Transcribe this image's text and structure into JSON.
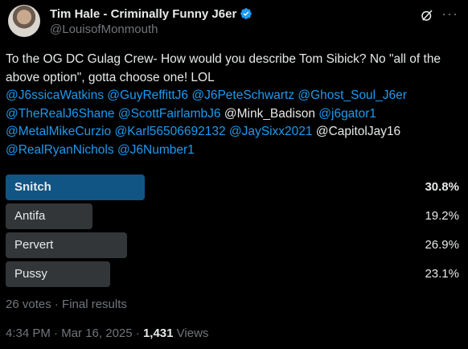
{
  "author": {
    "display_name": "Tim Hale - Criminally Funny J6er",
    "handle": "@LouisofMonmouth"
  },
  "tweet": {
    "segments": [
      {
        "text": "To the OG DC Gulag Crew- How would you describe Tom Sibick? No \"all of the above option\", gotta choose one! LOL",
        "type": "text"
      },
      {
        "text": "\n",
        "type": "break"
      },
      {
        "text": "@J6ssicaWatkins",
        "type": "mention"
      },
      {
        "text": " ",
        "type": "text"
      },
      {
        "text": "@GuyReffittJ6",
        "type": "mention"
      },
      {
        "text": " ",
        "type": "text"
      },
      {
        "text": "@J6PeteSchwartz",
        "type": "mention"
      },
      {
        "text": " ",
        "type": "text"
      },
      {
        "text": "@Ghost_Soul_J6er",
        "type": "mention"
      },
      {
        "text": " ",
        "type": "text"
      },
      {
        "text": "@TheRealJ6Shane",
        "type": "mention"
      },
      {
        "text": " ",
        "type": "text"
      },
      {
        "text": "@ScottFairlambJ6",
        "type": "mention"
      },
      {
        "text": " @Mink_Badison ",
        "type": "text"
      },
      {
        "text": "@j6gator1",
        "type": "mention"
      },
      {
        "text": " ",
        "type": "text"
      },
      {
        "text": "@MetalMikeCurzio",
        "type": "mention"
      },
      {
        "text": " ",
        "type": "text"
      },
      {
        "text": "@Karl56506692132",
        "type": "mention"
      },
      {
        "text": " ",
        "type": "text"
      },
      {
        "text": "@JaySixx2021",
        "type": "mention"
      },
      {
        "text": " @CapitolJay16 ",
        "type": "text"
      },
      {
        "text": "@RealRyanNichols",
        "type": "mention"
      },
      {
        "text": " ",
        "type": "text"
      },
      {
        "text": "@J6Number1",
        "type": "mention"
      }
    ]
  },
  "poll": {
    "options": [
      {
        "label": "Snitch",
        "percent_text": "30.8%",
        "percent": 30.8,
        "winner": true
      },
      {
        "label": "Antifa",
        "percent_text": "19.2%",
        "percent": 19.2,
        "winner": false
      },
      {
        "label": "Pervert",
        "percent_text": "26.9%",
        "percent": 26.9,
        "winner": false
      },
      {
        "label": "Pussy",
        "percent_text": "23.1%",
        "percent": 23.1,
        "winner": false
      }
    ],
    "meta": "26 votes · Final results"
  },
  "footer": {
    "time": "4:34 PM",
    "date": "Mar 16, 2025",
    "views_count": "1,431",
    "views_label": "Views"
  },
  "colors": {
    "accent": "#1d9bf0",
    "muted": "#71767b",
    "bar": "#333639"
  },
  "icons": [
    "verified-badge-icon",
    "grok-icon",
    "more-icon"
  ]
}
